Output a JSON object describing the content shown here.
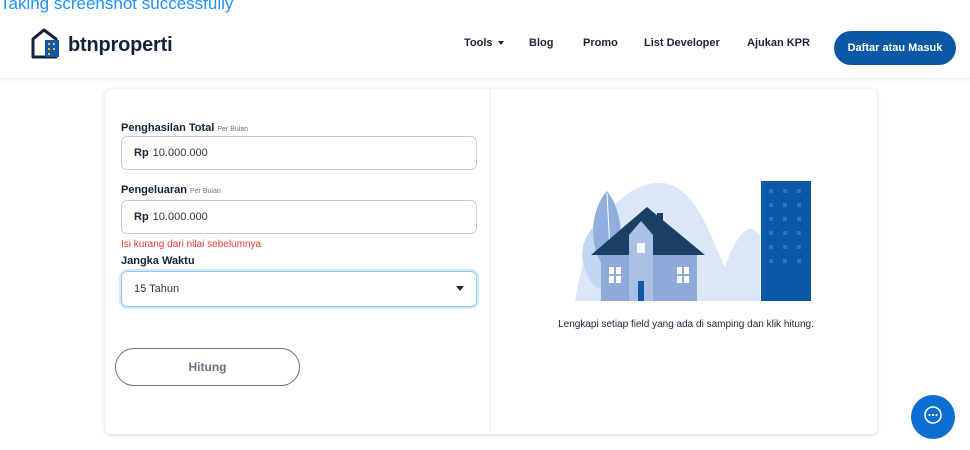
{
  "banner": {
    "text": "Taking screenshot successfully"
  },
  "brand": {
    "name": "btnproperti",
    "primary_color": "#0a58a6"
  },
  "nav": {
    "items": [
      {
        "label": "Tools"
      },
      {
        "label": "Blog"
      },
      {
        "label": "Promo"
      },
      {
        "label": "List Developer"
      },
      {
        "label": "Ajukan KPR"
      }
    ],
    "login_label": "Daftar atau Masuk"
  },
  "form": {
    "income": {
      "label": "Penghasilan Total",
      "sublabel": "Per Bulan",
      "currency": "Rp",
      "value": "10.000.000"
    },
    "expense": {
      "label": "Pengeluaran",
      "sublabel": "Per Bulan",
      "currency": "Rp",
      "value": "10.000.000",
      "error": "Isi kurang dari nilai sebelumnya"
    },
    "term": {
      "label": "Jangka Waktu",
      "selected": "15 Tahun"
    },
    "submit_label": "Hitung"
  },
  "result": {
    "hint": "Lengkapi setiap field yang ada di samping dan klik hitung."
  },
  "icons": {
    "chat": "chat-bubble-icon",
    "logo": "house-logo-icon",
    "dropdown": "chevron-down-icon"
  }
}
